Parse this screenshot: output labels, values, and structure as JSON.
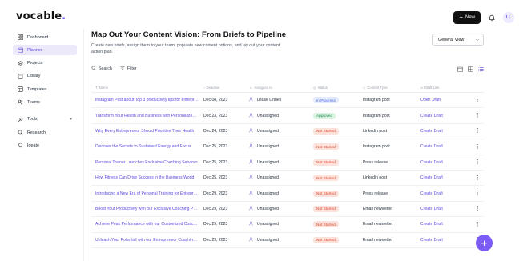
{
  "app": {
    "logo_text": "vocable",
    "logo_dot": "."
  },
  "topbar": {
    "new_label": "New",
    "avatar_initials": "LL"
  },
  "sidebar": {
    "items": [
      {
        "label": "Dashboard",
        "icon": "dashboard-icon"
      },
      {
        "label": "Planner",
        "icon": "calendar-icon",
        "active": true
      },
      {
        "label": "Projects",
        "icon": "layers-icon"
      },
      {
        "label": "Library",
        "icon": "book-icon"
      },
      {
        "label": "Templates",
        "icon": "template-icon"
      },
      {
        "label": "Teams",
        "icon": "users-icon"
      }
    ],
    "tools": [
      {
        "label": "Tools",
        "icon": "wrench-icon"
      },
      {
        "label": "Research",
        "icon": "search-icon"
      },
      {
        "label": "Ideate",
        "icon": "bulb-icon"
      }
    ]
  },
  "page": {
    "title": "Map Out Your Content Vision: From Briefs to Pipeline",
    "subtitle": "Create new briefs, assign them to your team, populate new content notions, and lay out your content action plan.",
    "view_select": "General View"
  },
  "toolbar": {
    "search_label": "Search",
    "filter_label": "Filter"
  },
  "table": {
    "headers": {
      "name": "Name",
      "deadline": "Deadline",
      "assigned": "Assigned to",
      "status": "Status",
      "type": "Content Type",
      "draft": "Draft Link"
    },
    "rows": [
      {
        "name": "Instagram Post about Top 3 productivity tips for entrepreneurs",
        "deadline": "Dec 08, 2023",
        "assigned": "Lease Linnes",
        "status": "In Progress",
        "status_kind": "ip",
        "type": "Instagram post",
        "draft": "Open Draft"
      },
      {
        "name": "Transform Your Health and Business with Personalized Coaching",
        "deadline": "Dec 23, 2023",
        "assigned": "Unassigned",
        "status": "Approved",
        "status_kind": "ap",
        "type": "Instagram post",
        "draft": "Create Draft"
      },
      {
        "name": "Why Every Entrepreneur Should Prioritize Their Health",
        "deadline": "Dec 24, 2023",
        "assigned": "Unassigned",
        "status": "Not Started",
        "status_kind": "ns",
        "type": "Linkedin post",
        "draft": "Create Draft"
      },
      {
        "name": "Discover the Secrets to Sustained Energy and Focus",
        "deadline": "Dec 25, 2023",
        "assigned": "Unassigned",
        "status": "Not Started",
        "status_kind": "ns",
        "type": "Instagram post",
        "draft": "Create Draft"
      },
      {
        "name": "Personal Trainer Launches Exclusive Coaching Services",
        "deadline": "Dec 25, 2023",
        "assigned": "Unassigned",
        "status": "Not Started",
        "status_kind": "ns",
        "type": "Press release",
        "draft": "Create Draft"
      },
      {
        "name": "How Fitness Can Drive Success in the Business World",
        "deadline": "Dec 25, 2023",
        "assigned": "Unassigned",
        "status": "Not Started",
        "status_kind": "ns",
        "type": "Linkedin post",
        "draft": "Create Draft"
      },
      {
        "name": "Introducing a New Era of Personal Training for Entrepreneurs",
        "deadline": "Dec 29, 2023",
        "assigned": "Unassigned",
        "status": "Not Started",
        "status_kind": "ns",
        "type": "Press release",
        "draft": "Create Draft"
      },
      {
        "name": "Boost Your Productivity with our Exclusive Coaching Program",
        "deadline": "Dec 29, 2023",
        "assigned": "Unassigned",
        "status": "Not Started",
        "status_kind": "ns",
        "type": "Email newsletter",
        "draft": "Create Draft"
      },
      {
        "name": "Achieve Peak Performance with our Customized Coaching",
        "deadline": "Dec 29, 2023",
        "assigned": "Unassigned",
        "status": "Not Started",
        "status_kind": "ns",
        "type": "Email newsletter",
        "draft": "Create Draft"
      },
      {
        "name": "Unleash Your Potential with our Entrepreneur Coaching Program",
        "deadline": "Dec 29, 2023",
        "assigned": "Unassigned",
        "status": "Not Started",
        "status_kind": "ns",
        "type": "Email newsletter",
        "draft": "Create Draft"
      }
    ]
  },
  "colors": {
    "accent": "#7c5cf5",
    "link": "#5b4ae0",
    "not_started": "#d9492e",
    "in_progress": "#4f6de0",
    "approved": "#239157"
  }
}
